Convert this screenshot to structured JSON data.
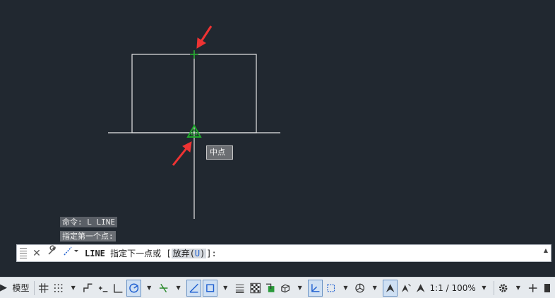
{
  "drawing": {
    "tooltip": "中点",
    "colors": {
      "background": "#212830",
      "line": "#e6e6e6",
      "snap_marker": "#1faa2a",
      "arrow": "#ee3333"
    }
  },
  "command_history": [
    "命令: L LINE",
    "指定第一个点:"
  ],
  "command_line": {
    "command": "LINE",
    "prompt": "指定下一点或 [",
    "option_label": "放弃(",
    "option_key": "U",
    "option_close": ")",
    "suffix": "]:"
  },
  "status_bar": {
    "model_tab": "模型",
    "scale": "1:1 / 100%"
  }
}
